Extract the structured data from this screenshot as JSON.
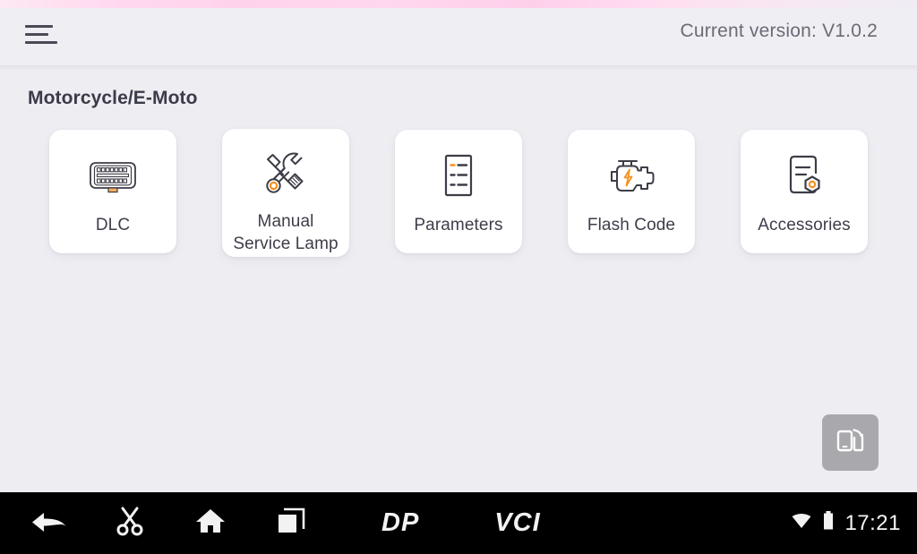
{
  "header": {
    "menu_icon": "hamburger-menu-icon",
    "version_label": "Current version: V1.0.2"
  },
  "main": {
    "page_title": "Motorcycle/E-Moto",
    "cards": [
      {
        "label": "DLC",
        "icon": "obd-connector-icon"
      },
      {
        "label": "Manual\nService Lamp",
        "label_line1": "Manual",
        "label_line2": "Service Lamp",
        "icon": "wrench-screwdriver-icon"
      },
      {
        "label": "Parameters",
        "icon": "document-list-icon"
      },
      {
        "label": "Flash Code",
        "icon": "check-engine-lightning-icon"
      },
      {
        "label": "Accessories",
        "icon": "document-hex-nut-icon"
      }
    ],
    "floating_button": {
      "name": "screen-rotate-button",
      "icon": "screen-rotate-icon"
    }
  },
  "navbar": {
    "items": [
      {
        "name": "back-button",
        "icon": "back-arrow-icon"
      },
      {
        "name": "screenshot-button",
        "icon": "scissors-icon"
      },
      {
        "name": "home-button",
        "icon": "home-icon"
      },
      {
        "name": "recent-apps-button",
        "icon": "recent-apps-icon"
      }
    ],
    "logo_dp": "DP",
    "logo_vci": "VCI",
    "status": {
      "wifi_icon": "wifi-icon",
      "battery_icon": "battery-icon",
      "clock": "17:21"
    }
  },
  "colors": {
    "background": "#eeedf2",
    "header_bg": "#efeef3",
    "card_bg": "#ffffff",
    "accent_orange": "#f5911e",
    "icon_stroke": "#3d3d48",
    "text_dark": "#3b3b49",
    "text_muted": "#6c6b76",
    "navbar_bg": "#000000",
    "fab_bg": "#a8a8ad"
  }
}
